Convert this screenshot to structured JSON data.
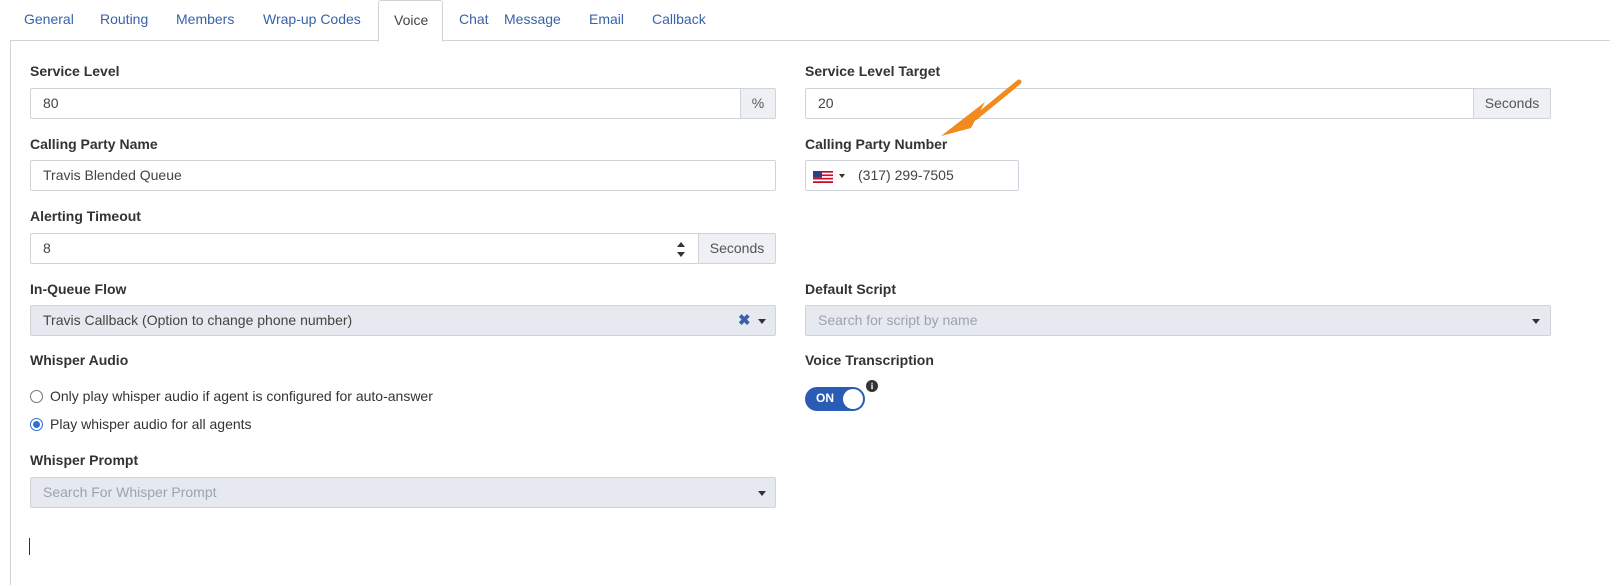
{
  "tabs": [
    {
      "label": "General",
      "active": false
    },
    {
      "label": "Routing",
      "active": false
    },
    {
      "label": "Members",
      "active": false
    },
    {
      "label": "Wrap-up Codes",
      "active": false
    },
    {
      "label": "Voice",
      "active": true
    },
    {
      "label": "Chat",
      "active": false
    },
    {
      "label": "Message",
      "active": false
    },
    {
      "label": "Email",
      "active": false
    },
    {
      "label": "Callback",
      "active": false
    }
  ],
  "service_level": {
    "label": "Service Level",
    "value": "80",
    "unit": "%"
  },
  "service_level_target": {
    "label": "Service Level Target",
    "value": "20",
    "unit": "Seconds"
  },
  "calling_party_name": {
    "label": "Calling Party Name",
    "value": "Travis Blended Queue"
  },
  "calling_party_number": {
    "label": "Calling Party Number",
    "value": "(317) 299-7505",
    "country_icon": "us-flag-icon"
  },
  "alerting_timeout": {
    "label": "Alerting Timeout",
    "value": "8",
    "unit": "Seconds"
  },
  "in_queue_flow": {
    "label": "In-Queue Flow",
    "value": "Travis Callback (Option to change phone number)"
  },
  "default_script": {
    "label": "Default Script",
    "placeholder": "Search for script by name"
  },
  "whisper_audio": {
    "label": "Whisper Audio",
    "options": [
      {
        "label": "Only play whisper audio if agent is configured for auto-answer",
        "checked": false
      },
      {
        "label": "Play whisper audio for all agents",
        "checked": true
      }
    ]
  },
  "voice_transcription": {
    "label": "Voice Transcription",
    "toggle_text": "ON",
    "enabled": true
  },
  "whisper_prompt": {
    "label": "Whisper Prompt",
    "placeholder": "Search For Whisper Prompt"
  },
  "colors": {
    "link": "#3a62a8",
    "toggle": "#2b5cb5",
    "arrow": "#f28a1e",
    "disabled_bg": "#e6eaf0"
  },
  "annotation": {
    "icon": "orange-arrow-icon"
  }
}
